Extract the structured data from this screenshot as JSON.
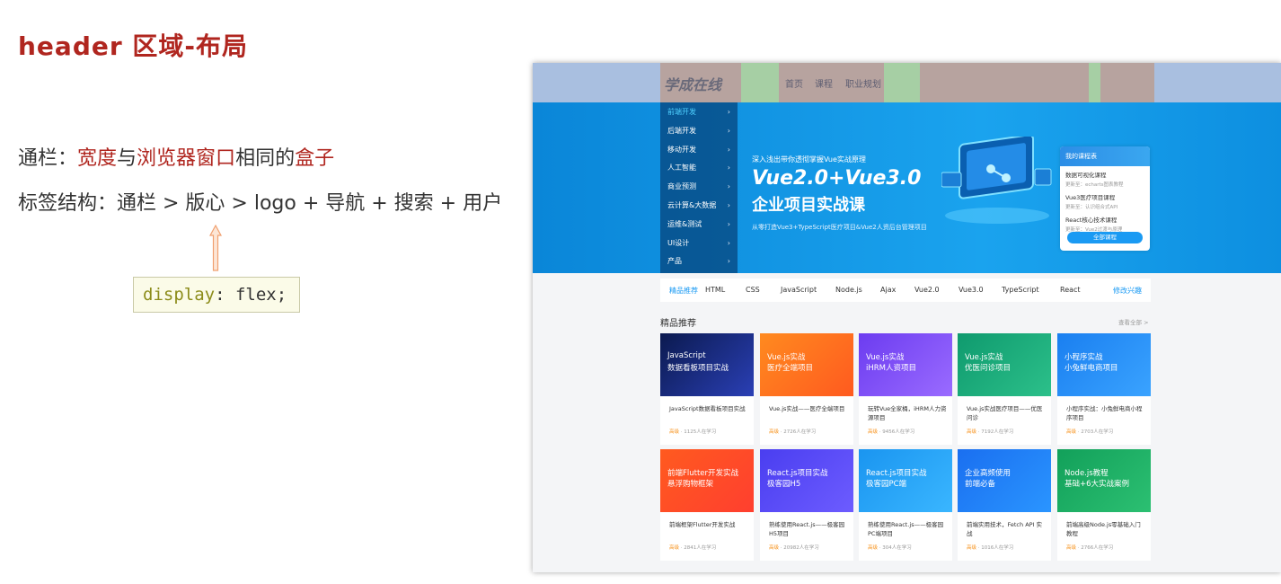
{
  "slide": {
    "title": "header 区域-布局",
    "line1": {
      "a": "通栏：",
      "b": "宽度",
      "c": "与",
      "d": "浏览器窗口",
      "e": "相同的",
      "f": "盒子"
    },
    "line2": "标签结构：通栏 > 版心 > logo + 导航 + 搜索 + 用户",
    "code": {
      "prop": "display",
      "rest": ": flex;"
    }
  },
  "site": {
    "logo": "学成在线",
    "nav": [
      "首页",
      "课程",
      "职业规划"
    ],
    "search_placeholder": "",
    "user": "",
    "menu": [
      "前端开发",
      "后端开发",
      "移动开发",
      "人工智能",
      "商业预测",
      "云计算&大数据",
      "运维&测试",
      "UI设计",
      "产品"
    ],
    "banner": {
      "sub": "深入浅出带你透彻掌握Vue实战原理",
      "title1": "Vue2.0+Vue3.0",
      "title2": "企业项目实战课",
      "desc": "从零打造Vue3+TypeScript医疗项目&Vue2人资后台管理项目"
    },
    "my_courses": {
      "title": "我的课程表",
      "items": [
        {
          "name": "数据可视化课程",
          "meta": "更新至：echarts图表教程"
        },
        {
          "name": "Vue3医疗项目课程",
          "meta": "更新至：认识组合式API"
        },
        {
          "name": "React核心技术课程",
          "meta": "更新至：Vue2过渡与原理"
        }
      ],
      "button": "全部课程"
    },
    "recommend_bar": {
      "label": "精品推荐",
      "items": [
        "HTML",
        "CSS",
        "JavaScript",
        "Node.js",
        "Ajax",
        "Vue2.0",
        "Vue3.0",
        "TypeScript",
        "React"
      ],
      "more": "修改兴趣"
    },
    "section": {
      "title": "精品推荐",
      "more": "查看全部 >"
    },
    "cards": [
      {
        "t1": "JavaScript",
        "t2": "数据看板项目实战",
        "title": "JavaScript数据看板项目实战",
        "level": "高级",
        "count": "1125人在学习",
        "color1": "#0b1a4f",
        "color2": "#2a3fb5"
      },
      {
        "t1": "Vue.js实战",
        "t2": "医疗全端项目",
        "title": "Vue.js实战——医疗全端项目",
        "level": "高级",
        "count": "2726人在学习",
        "color1": "#ff8a1f",
        "color2": "#ff5a1f"
      },
      {
        "t1": "Vue.js实战",
        "t2": "iHRM人资项目",
        "title": "玩转Vue全家桶，iHRM人力资源项目",
        "level": "高级",
        "count": "9456人在学习",
        "color1": "#6c3cf0",
        "color2": "#9a6bff"
      },
      {
        "t1": "Vue.js实战",
        "t2": "优医问诊项目",
        "title": "Vue.js实战医疗项目——优医问诊",
        "level": "高级",
        "count": "7192人在学习",
        "color1": "#0f9a6e",
        "color2": "#2cc08a"
      },
      {
        "t1": "小程序实战",
        "t2": "小兔鲜电商项目",
        "title": "小程序实战：小兔鲜电商小程序项目",
        "level": "高级",
        "count": "2703人在学习",
        "color1": "#1a7ff0",
        "color2": "#3aa3ff"
      },
      {
        "t1": "前端Flutter开发实战",
        "t2": "悬浮购物框架",
        "title": "前端框架Flutter开发实战",
        "level": "高级",
        "count": "2841人在学习",
        "color1": "#ff5a1f",
        "color2": "#ff3f2f"
      },
      {
        "t1": "React.js项目实战",
        "t2": "极客园H5",
        "title": "熟练使用React.js——极客园H5项目",
        "level": "高级",
        "count": "20982人在学习",
        "color1": "#4a3ef0",
        "color2": "#6d5cff"
      },
      {
        "t1": "React.js项目实战",
        "t2": "极客园PC端",
        "title": "熟练使用React.js——极客园PC端项目",
        "level": "高级",
        "count": "304人在学习",
        "color1": "#1a95f0",
        "color2": "#3ab6ff"
      },
      {
        "t1": "企业高频使用",
        "t2": "前端必备",
        "title": "前端实用技术，Fetch API 实战",
        "level": "高级",
        "count": "1016人在学习",
        "color1": "#1a6ff0",
        "color2": "#2a95ff"
      },
      {
        "t1": "Node.js教程",
        "t2": "基础+6大实战案例",
        "title": "前端高级Node.js零基础入门教程",
        "level": "高级",
        "count": "2766人在学习",
        "color1": "#12a05a",
        "color2": "#2cc072"
      }
    ]
  }
}
